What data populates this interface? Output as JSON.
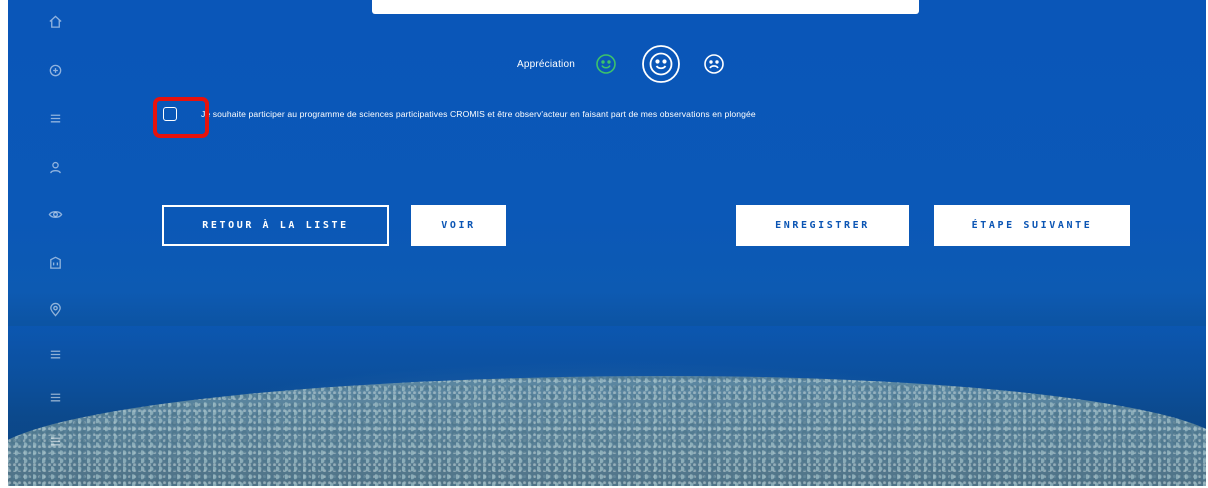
{
  "colors": {
    "background": "#0b58b7",
    "accent_green": "#3cc26b",
    "button_text": "#0b55b4",
    "highlight_red": "#e8120c"
  },
  "sidebar": {
    "items": [
      {
        "icon": "home-icon"
      },
      {
        "icon": "plus-circle-icon"
      },
      {
        "icon": "list-icon"
      },
      {
        "icon": "user-icon"
      },
      {
        "icon": "eye-icon"
      },
      {
        "icon": "building-icon"
      },
      {
        "icon": "location-icon"
      },
      {
        "icon": "list-icon"
      },
      {
        "icon": "list-icon"
      },
      {
        "icon": "list-icon"
      }
    ]
  },
  "rating": {
    "label": "Appréciation",
    "options": [
      {
        "icon": "happy-face-icon",
        "color": "#3cc26b"
      },
      {
        "icon": "neutral-face-icon",
        "color": "#ffffff",
        "selected": true
      },
      {
        "icon": "sad-face-icon",
        "color": "#ffffff"
      }
    ]
  },
  "participation": {
    "checked": false,
    "text": "Je souhaite participer au programme de sciences participatives CROMIS et être observ'acteur en faisant part de mes observations en plongée"
  },
  "buttons": {
    "back": "RETOUR À LA LISTE",
    "view": "VOIR",
    "save": "ENREGISTRER",
    "next": "ÉTAPE SUIVANTE"
  }
}
